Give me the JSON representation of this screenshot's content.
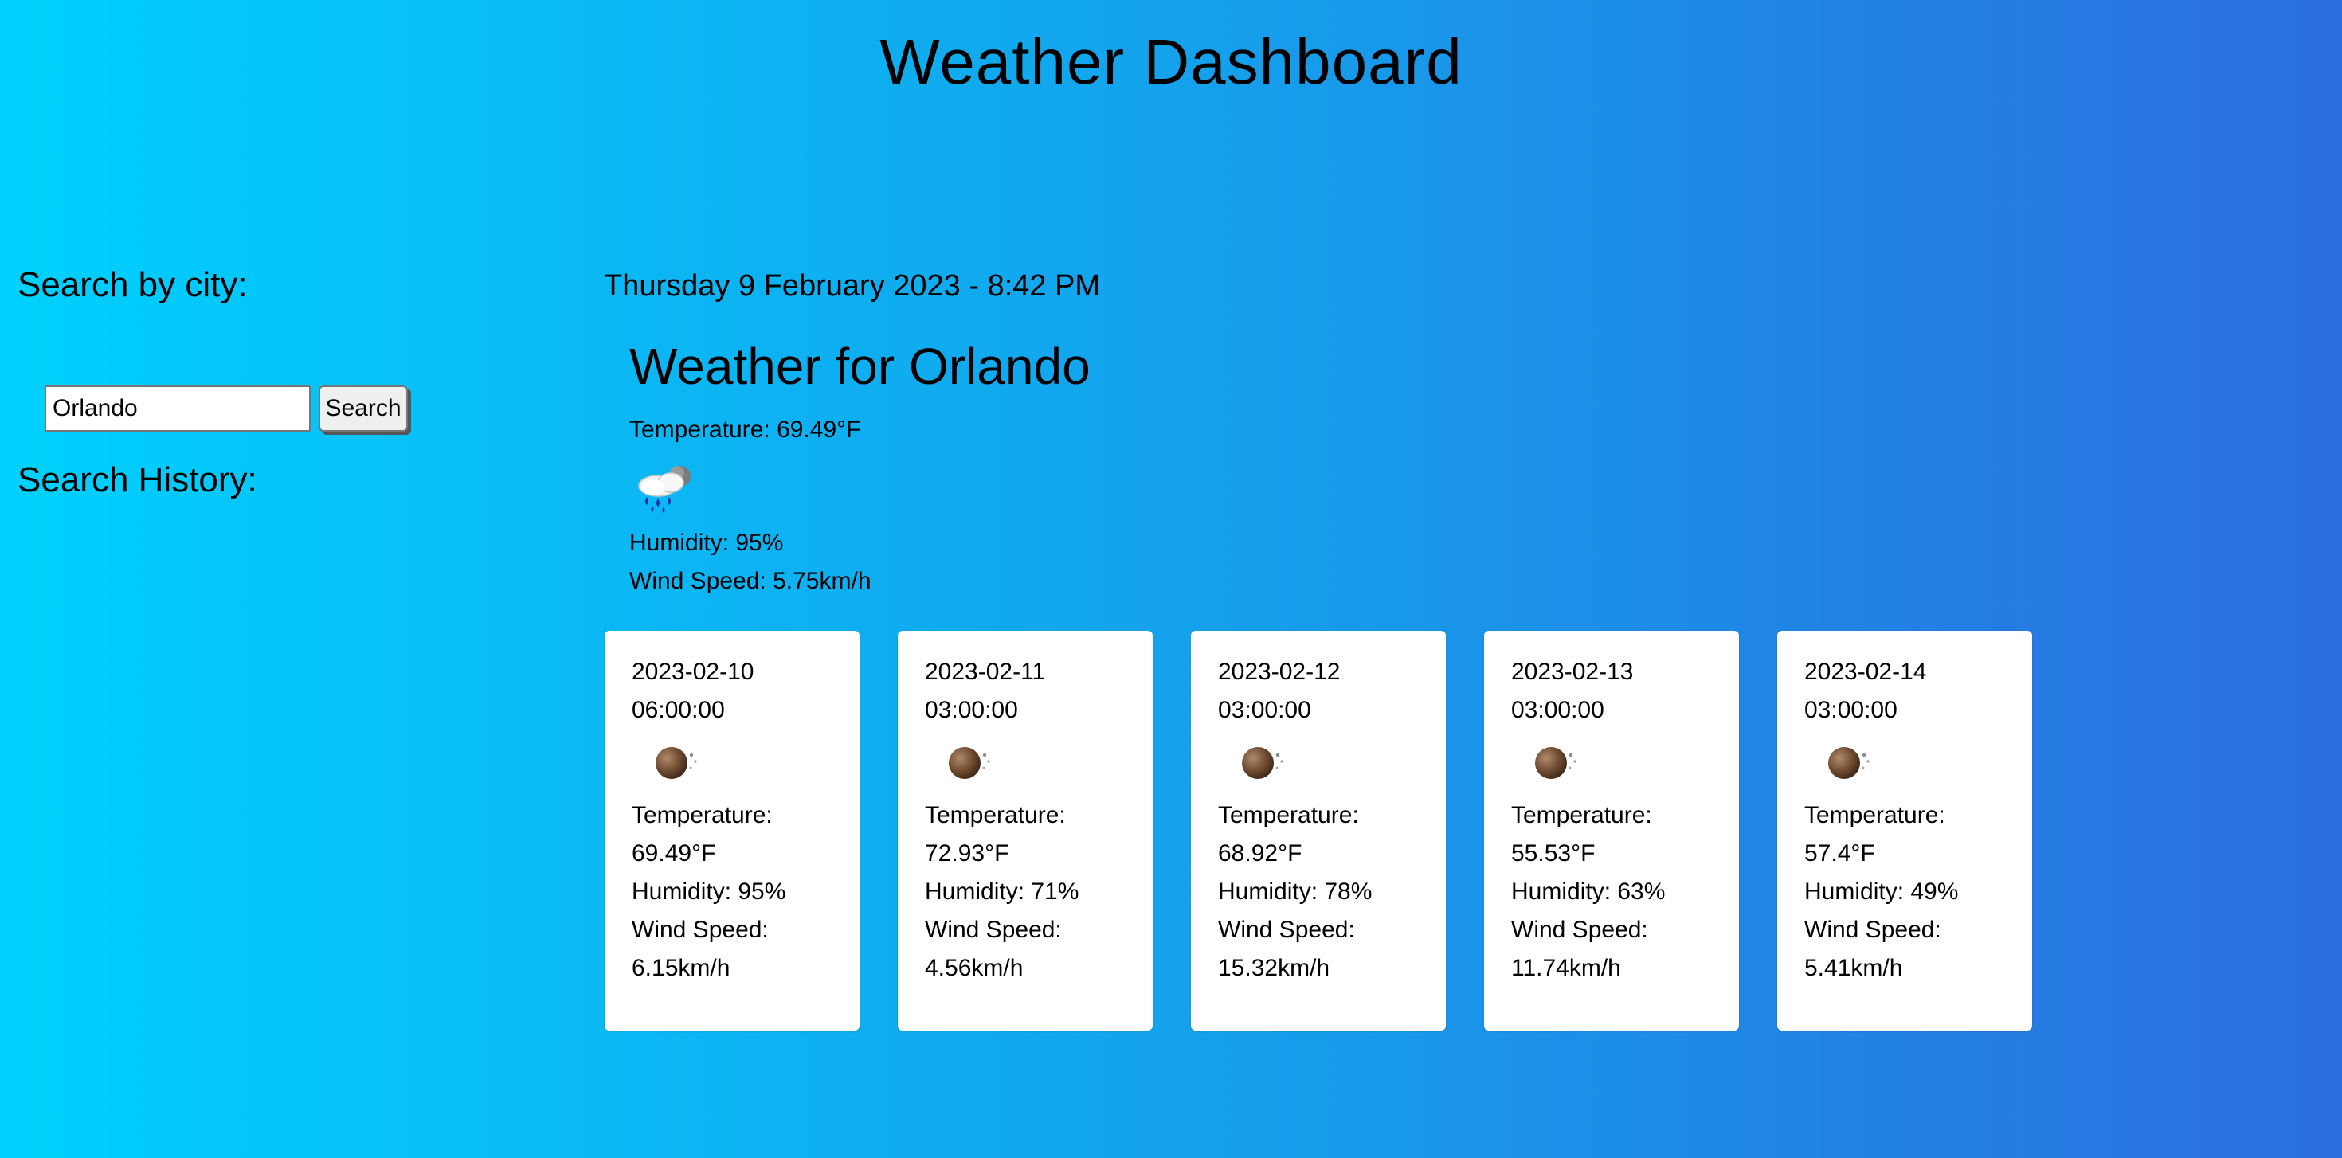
{
  "header": {
    "title": "Weather Dashboard"
  },
  "sidebar": {
    "search_heading": "Search by city:",
    "search_input_value": "Orlando",
    "search_button_label": "Search",
    "history_heading": "Search History:"
  },
  "current": {
    "datetime": "Thursday 9 February 2023 - 8:42 PM",
    "city_title": "Weather for Orlando",
    "temperature": "Temperature: 69.49°F",
    "icon": "rain-cloud-icon",
    "humidity": "Humidity: 95%",
    "wind": "Wind Speed: 5.75km/h"
  },
  "forecast": [
    {
      "date": "2023-02-10",
      "time": "06:00:00",
      "icon": "moon-icon",
      "temp_label": "Temperature:",
      "temp_value": "69.49°F",
      "humidity": "Humidity: 95%",
      "wind_label": "Wind Speed:",
      "wind_value": "6.15km/h"
    },
    {
      "date": "2023-02-11",
      "time": "03:00:00",
      "icon": "moon-icon",
      "temp_label": "Temperature:",
      "temp_value": "72.93°F",
      "humidity": "Humidity: 71%",
      "wind_label": "Wind Speed:",
      "wind_value": "4.56km/h"
    },
    {
      "date": "2023-02-12",
      "time": "03:00:00",
      "icon": "moon-icon",
      "temp_label": "Temperature:",
      "temp_value": "68.92°F",
      "humidity": "Humidity: 78%",
      "wind_label": "Wind Speed:",
      "wind_value": "15.32km/h"
    },
    {
      "date": "2023-02-13",
      "time": "03:00:00",
      "icon": "moon-icon",
      "temp_label": "Temperature:",
      "temp_value": "55.53°F",
      "humidity": "Humidity: 63%",
      "wind_label": "Wind Speed:",
      "wind_value": "11.74km/h"
    },
    {
      "date": "2023-02-14",
      "time": "03:00:00",
      "icon": "moon-icon",
      "temp_label": "Temperature:",
      "temp_value": "57.4°F",
      "humidity": "Humidity: 49%",
      "wind_label": "Wind Speed:",
      "wind_value": "5.41km/h"
    }
  ],
  "colors": {
    "gradient_start": "#00d1fd",
    "gradient_end": "#2b6ddf",
    "card_background": "#ffffff"
  }
}
